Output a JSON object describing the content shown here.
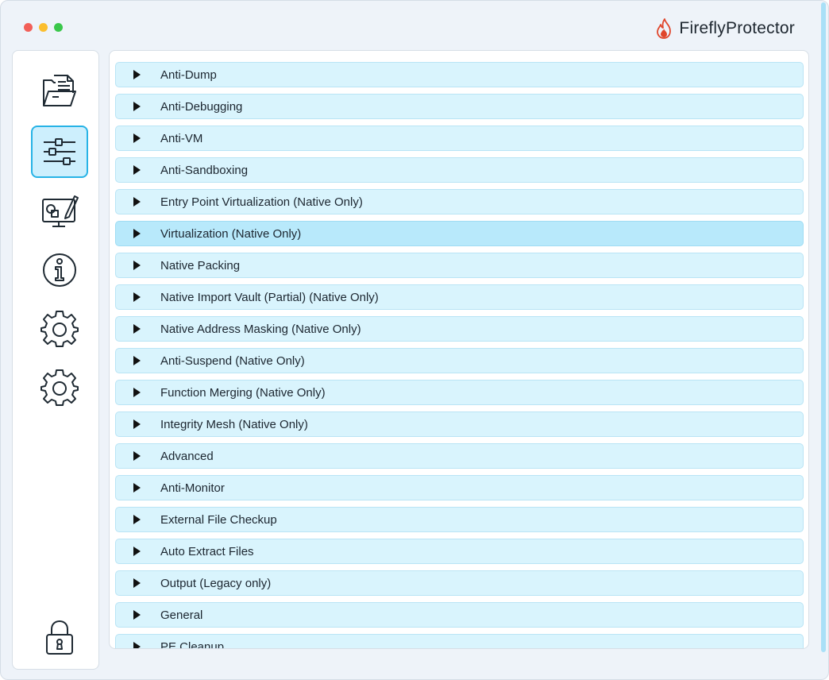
{
  "window": {
    "app_title": "FireflyProtector"
  },
  "sidebar": {
    "items": [
      {
        "name": "open-file",
        "icon": "folder-document-icon"
      },
      {
        "name": "protection-options",
        "icon": "sliders-icon",
        "active": true
      },
      {
        "name": "virtualization-editor",
        "icon": "monitor-pen-icon"
      },
      {
        "name": "about",
        "icon": "info-icon"
      },
      {
        "name": "settings",
        "icon": "gear-icon"
      },
      {
        "name": "advanced-settings",
        "icon": "gear-icon"
      },
      {
        "name": "license",
        "icon": "lock-icon"
      }
    ]
  },
  "sections": [
    {
      "label": "Anti-Dump"
    },
    {
      "label": "Anti-Debugging"
    },
    {
      "label": "Anti-VM"
    },
    {
      "label": "Anti-Sandboxing"
    },
    {
      "label": "Entry Point Virtualization (Native Only)"
    },
    {
      "label": "Virtualization (Native Only)"
    },
    {
      "label": "Native Packing"
    },
    {
      "label": "Native Import Vault (Partial) (Native Only)"
    },
    {
      "label": "Native Address Masking (Native Only)"
    },
    {
      "label": "Anti-Suspend (Native Only)"
    },
    {
      "label": "Function Merging (Native Only)"
    },
    {
      "label": "Integrity Mesh (Native Only)"
    },
    {
      "label": "Advanced"
    },
    {
      "label": "Anti-Monitor"
    },
    {
      "label": "External File Checkup"
    },
    {
      "label": "Auto Extract Files"
    },
    {
      "label": "Output (Legacy only)"
    },
    {
      "label": "General"
    },
    {
      "label": "PE Cleanup"
    }
  ],
  "colors": {
    "accent": "#27b3e6",
    "section_bg": "#d9f4fd",
    "section_hover_bg": "#b8e9fb",
    "brand_flame": "#e0452b"
  }
}
